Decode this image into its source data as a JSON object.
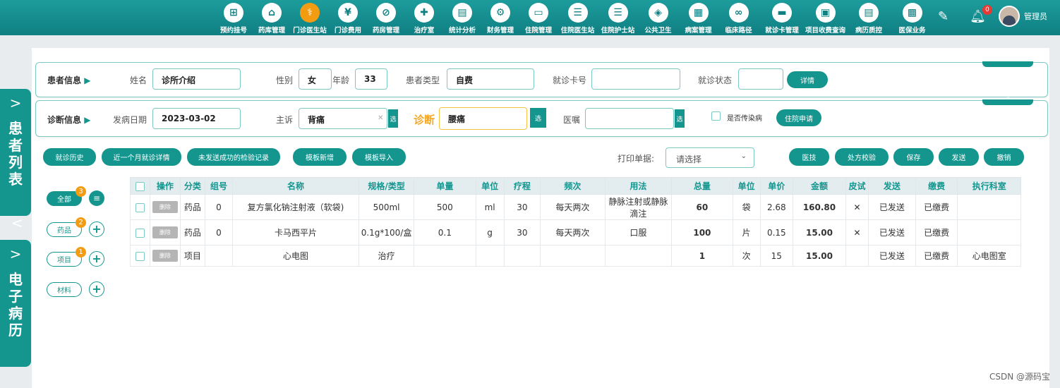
{
  "nav": {
    "items": [
      {
        "label": "预约挂号",
        "icon": "calendar-icon",
        "glyph": "⊞"
      },
      {
        "label": "药库管理",
        "icon": "warehouse-icon",
        "glyph": "⌂"
      },
      {
        "label": "门诊医生站",
        "icon": "doctor-icon",
        "glyph": "⚕"
      },
      {
        "label": "门诊费用",
        "icon": "yen-icon",
        "glyph": "¥"
      },
      {
        "label": "药房管理",
        "icon": "pill-icon",
        "glyph": "⊘"
      },
      {
        "label": "治疗室",
        "icon": "nurse-icon",
        "glyph": "✚"
      },
      {
        "label": "统计分析",
        "icon": "chart-icon",
        "glyph": "▤"
      },
      {
        "label": "财务管理",
        "icon": "gear-icon",
        "glyph": "⚙"
      },
      {
        "label": "住院管理",
        "icon": "bed-icon",
        "glyph": "▭"
      },
      {
        "label": "住院医生站",
        "icon": "doctor-card-icon",
        "glyph": "☰"
      },
      {
        "label": "住院护士站",
        "icon": "nurse-card-icon",
        "glyph": "☰"
      },
      {
        "label": "公共卫生",
        "icon": "public-health-icon",
        "glyph": "◈"
      },
      {
        "label": "病案管理",
        "icon": "record-icon",
        "glyph": "▦"
      },
      {
        "label": "临床路径",
        "icon": "path-icon",
        "glyph": "∞"
      },
      {
        "label": "就诊卡管理",
        "icon": "card-icon",
        "glyph": "▬"
      },
      {
        "label": "项目收费查询",
        "icon": "search-doc-icon",
        "glyph": "▣"
      },
      {
        "label": "病历质控",
        "icon": "clipboard-icon",
        "glyph": "▤"
      },
      {
        "label": "医保业务",
        "icon": "insurance-icon",
        "glyph": "▩"
      }
    ],
    "notification_count": "0",
    "username": "管理员"
  },
  "side_tabs": {
    "patient_list": [
      "患",
      "者",
      "列",
      "表"
    ],
    "emr": [
      "电",
      "子",
      "病",
      "历"
    ]
  },
  "patient": {
    "section_title": "患者信息",
    "name_label": "姓名",
    "name_value": "诊所介绍",
    "gender_label": "性别",
    "gender_value": "女",
    "age_label": "年龄",
    "age_value": "33",
    "type_label": "患者类型",
    "type_value": "自费",
    "card_label": "就诊卡号",
    "card_value": "",
    "status_label": "就诊状态",
    "status_value": "",
    "detail_button": "详情"
  },
  "diagnosis": {
    "section_title": "诊断信息",
    "onset_label": "发病日期",
    "onset_value": "2023-03-02",
    "complaint_label": "主诉",
    "complaint_value": "背痛",
    "select_label": "选",
    "diag_label": "诊断",
    "diag_value": "腰痛",
    "advice_label": "医嘱",
    "advice_value": "",
    "infectious_label": "是否传染病",
    "admit_button": "住院申请"
  },
  "toolbar": {
    "history": "就诊历史",
    "month_detail": "近一个月就诊详情",
    "unsent_exam": "未发送成功的检验记录",
    "template_add": "模板新增",
    "template_import": "模板导入",
    "print_label": "打印单据:",
    "print_placeholder": "请选择",
    "tech": "医技",
    "rx_check": "处方校验",
    "save": "保存",
    "send": "发送",
    "revoke": "撤销"
  },
  "categories": [
    {
      "label": "全部",
      "count": "3"
    },
    {
      "label": "药品",
      "count": "2"
    },
    {
      "label": "项目",
      "count": "1"
    },
    {
      "label": "材料",
      "count": ""
    }
  ],
  "table": {
    "headers": [
      "",
      "操作",
      "分类",
      "组号",
      "名称",
      "规格/类型",
      "单量",
      "单位",
      "疗程",
      "频次",
      "用法",
      "总量",
      "单位",
      "单价",
      "金额",
      "皮试",
      "发送",
      "缴费",
      "执行科室"
    ],
    "delete_label": "删除",
    "rows": [
      {
        "category": "药品",
        "group": "0",
        "name": "复方氯化钠注射液（软袋)",
        "spec": "500ml",
        "dose": "500",
        "dose_unit": "ml",
        "course": "30",
        "freq": "每天两次",
        "usage": "静脉注射或静脉滴注",
        "total": "60",
        "unit": "袋",
        "price": "2.68",
        "amount": "160.80",
        "skin": "✕",
        "sent": "已发送",
        "paid": "已缴费",
        "dept": ""
      },
      {
        "category": "药品",
        "group": "0",
        "name": "卡马西平片",
        "spec": "0.1g*100/盒",
        "dose": "0.1",
        "dose_unit": "g",
        "course": "30",
        "freq": "每天两次",
        "usage": "口服",
        "total": "100",
        "unit": "片",
        "price": "0.15",
        "amount": "15.00",
        "skin": "✕",
        "sent": "已发送",
        "paid": "已缴费",
        "dept": ""
      },
      {
        "category": "项目",
        "group": "",
        "name": "心电图",
        "spec": "治疗",
        "dose": "",
        "dose_unit": "",
        "course": "",
        "freq": "",
        "usage": "",
        "total": "1",
        "unit": "次",
        "price": "15",
        "amount": "15.00",
        "skin": "",
        "sent": "已发送",
        "paid": "已缴费",
        "dept": "心电图室"
      }
    ]
  },
  "watermark": "CSDN @源码宝",
  "colors": {
    "primary": "#14968f",
    "accent": "#f39c12",
    "danger": "#e53935",
    "success": "#2eaa4a"
  }
}
